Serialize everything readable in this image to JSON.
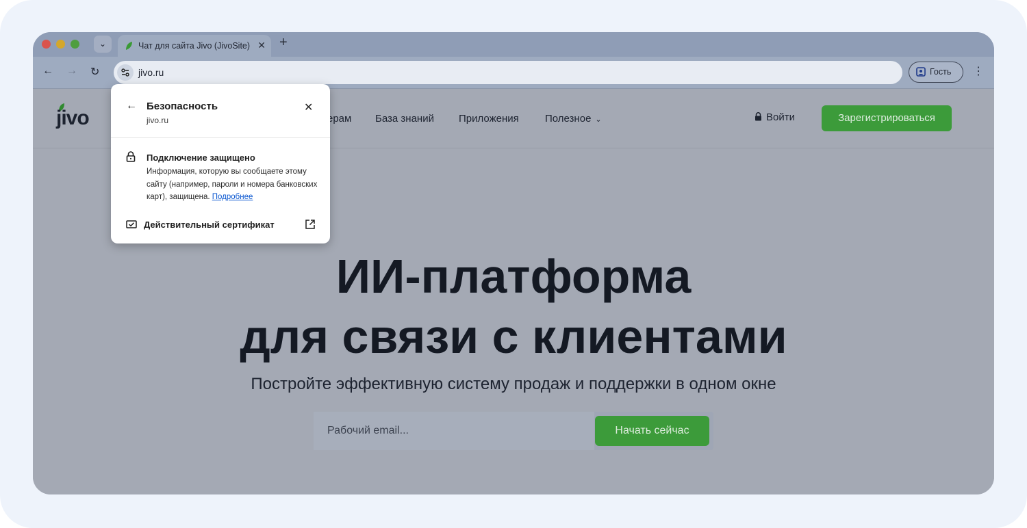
{
  "browser": {
    "tab": {
      "title": "Чат для сайта Jivo (JivoSite)",
      "close_icon": "close-icon",
      "new_tab_icon": "plus-icon"
    },
    "url": "jivo.ru",
    "profile_label": "Гость"
  },
  "site": {
    "logo": "jivo",
    "nav": {
      "partners_partial": "ерам",
      "knowledge_base": "База знаний",
      "apps": "Приложения",
      "useful": "Полезное"
    },
    "login": "Войти",
    "register": "Зарегистрироваться"
  },
  "hero": {
    "title_line1": "ИИ-платформа",
    "title_line2": "для связи с клиентами",
    "subtitle": "Постройте эффективную систему продаж и поддержки в одном окне",
    "email_placeholder": "Рабочий email...",
    "cta": "Начать сейчас"
  },
  "security_popup": {
    "title": "Безопасность",
    "domain": "jivo.ru",
    "connection_title": "Подключение защищено",
    "connection_text": "Информация, которую вы сообщаете этому сайту (например, пароли и номера банковских карт), защищена.",
    "more_link": "Подробнее",
    "certificate": "Действительный сертификат"
  },
  "colors": {
    "accent_green": "#3c9b3a",
    "link_blue": "#0b57d0",
    "overlay_page": "#a4a9b4"
  }
}
